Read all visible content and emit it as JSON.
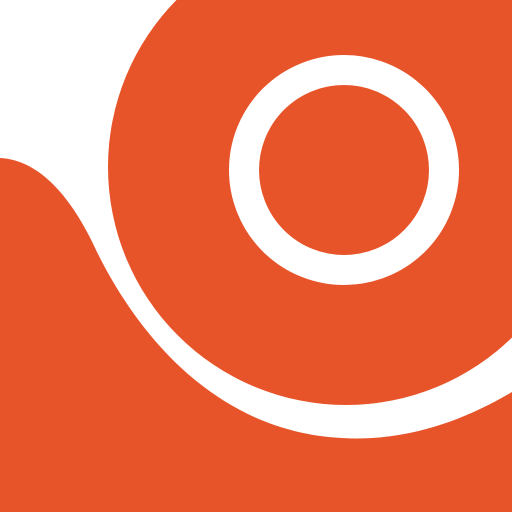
{
  "graphic": {
    "icon": "circular-wave-logo-icon",
    "colors": {
      "primary": "#E8542A",
      "background": "#FFFFFF"
    }
  }
}
